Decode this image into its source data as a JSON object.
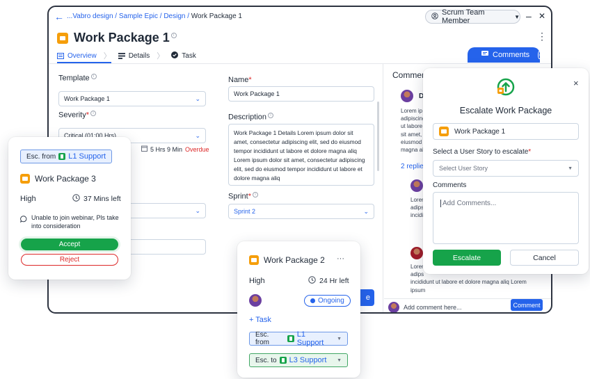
{
  "breadcrumb": {
    "path": "...Vabro design / Sample Epic / Design / ",
    "current": "Work Package 1"
  },
  "window": {
    "role": "Scrum Team Member",
    "minimize": "–",
    "close": "✕",
    "more": "⋮"
  },
  "page": {
    "title": "Work Package 1",
    "tabs": [
      {
        "label": "Overview",
        "active": true
      },
      {
        "label": "Details",
        "active": false
      },
      {
        "label": "Task",
        "active": false
      }
    ],
    "comments_button": "Comments"
  },
  "form": {
    "template": {
      "label": "Template",
      "value": "Work Package 1"
    },
    "severity": {
      "label": "Severity",
      "value": "Critical (01:00 Hrs)"
    },
    "time_left": "5 Hrs 9 Min",
    "time_status": "Overdue",
    "assignee_partial": "ster",
    "name": {
      "label": "Name",
      "value": "Work Package 1"
    },
    "description": {
      "label": "Description",
      "value": "Work Package 1 Details Lorem ipsum dolor sit amet, consectetur adipiscing elit, sed do eiusmod tempor incididunt ut labore et dolore magna aliq Lorem ipsum dolor sit amet, consectetur adipiscing elit, sed do eiusmod tempor incididunt ut labore et dolore magna aliq"
    },
    "sprint": {
      "label": "Sprint",
      "value": "Sprint 2"
    },
    "partial_button": "e"
  },
  "comments_panel": {
    "title": "Comment",
    "author_initial": "D",
    "text_1": "Lorem ip adipiscing ut labore sit amet, eiusmod magna al",
    "replies": "2 replie",
    "reply_1": "Lorer adips incidi",
    "reply_2_lines": [
      "Lorer",
      "adips",
      "incididunt ut labore et dolore magna aliq Lorem",
      "ipsum"
    ],
    "input_placeholder": "Add comment here...",
    "submit": "Comment"
  },
  "escalate_modal": {
    "title": "Escalate Work Package",
    "package": "Work Package  1",
    "user_story_label": "Select a User Story to escalate",
    "user_story_placeholder": "Select User Story",
    "comments_label": "Comments",
    "comments_placeholder": "Add Comments...",
    "escalate": "Escalate",
    "cancel": "Cancel",
    "close": "×"
  },
  "wp3_card": {
    "esc_from_prefix": "Esc. from",
    "esc_from_team": "L1 Support",
    "title": "Work Package 3",
    "priority": "High",
    "time_left": "37 Mins left",
    "note": "Unable to join webinar, Pls take into consideration",
    "accept": "Accept",
    "reject": "Reject"
  },
  "wp2_card": {
    "title": "Work Package  2",
    "more": "···",
    "priority": "High",
    "time_left": "24 Hr left",
    "status": "Ongoing",
    "add_task": "+ Task",
    "esc_from_prefix": "Esc. from",
    "esc_from_team": "L1 Support",
    "esc_to_prefix": "Esc. to",
    "esc_to_team": "L3 Support"
  },
  "colors": {
    "accent": "#2563eb",
    "success": "#16a34a",
    "danger": "#dc2626",
    "package": "#f59e0b"
  }
}
